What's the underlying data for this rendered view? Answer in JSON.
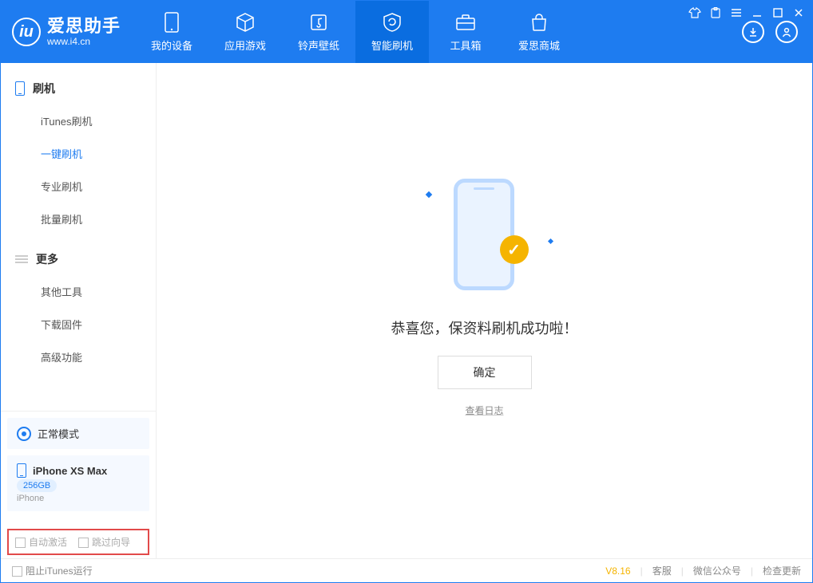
{
  "colors": {
    "accent": "#1e7cf0",
    "warn": "#f5b400",
    "highlight_border": "#e24a4a"
  },
  "logo": {
    "icon_letter": "iu",
    "title": "爱思助手",
    "subtitle": "www.i4.cn"
  },
  "nav": {
    "items": [
      {
        "label": "我的设备",
        "icon": "phone-icon",
        "active": false
      },
      {
        "label": "应用游戏",
        "icon": "cube-icon",
        "active": false
      },
      {
        "label": "铃声壁纸",
        "icon": "music-note-icon",
        "active": false
      },
      {
        "label": "智能刷机",
        "icon": "refresh-shield-icon",
        "active": true
      },
      {
        "label": "工具箱",
        "icon": "toolbox-icon",
        "active": false
      },
      {
        "label": "爱思商城",
        "icon": "bag-icon",
        "active": false
      }
    ]
  },
  "window_icons": [
    "tshirt-icon",
    "clipboard-icon",
    "menu-icon",
    "minimize-icon",
    "maximize-icon",
    "close-icon"
  ],
  "user_icons": {
    "download": "download-circle-icon",
    "user": "user-circle-icon"
  },
  "sidebar": {
    "group1": {
      "title": "刷机",
      "items": [
        "iTunes刷机",
        "一键刷机",
        "专业刷机",
        "批量刷机"
      ],
      "active_index": 1
    },
    "group2": {
      "title": "更多",
      "items": [
        "其他工具",
        "下载固件",
        "高级功能"
      ]
    }
  },
  "device_status": {
    "mode_label": "正常模式"
  },
  "device_info": {
    "name": "iPhone XS Max",
    "capacity": "256GB",
    "type": "iPhone"
  },
  "bottom_options": {
    "opt1": "自动激活",
    "opt2": "跳过向导"
  },
  "main": {
    "success_title": "恭喜您，保资料刷机成功啦！",
    "ok_label": "确定",
    "log_link": "查看日志"
  },
  "statusbar": {
    "stop_itunes": "阻止iTunes运行",
    "version": "V8.16",
    "links": [
      "客服",
      "微信公众号",
      "检查更新"
    ]
  }
}
